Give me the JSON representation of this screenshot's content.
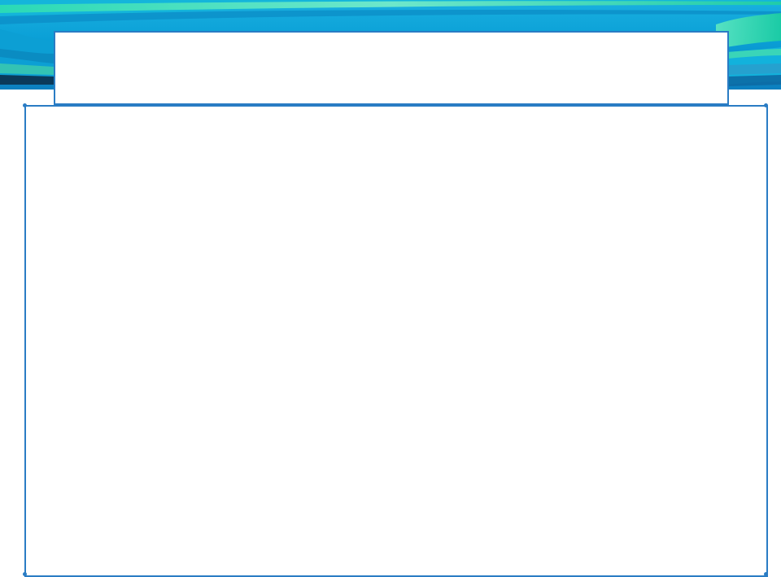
{
  "slide": {
    "title": "",
    "body": ""
  },
  "colors": {
    "accent": "#2a7cc4",
    "banner_blue": "#0aa0d8",
    "banner_teal": "#22d0a0",
    "banner_dark": "#0a3a5a"
  }
}
